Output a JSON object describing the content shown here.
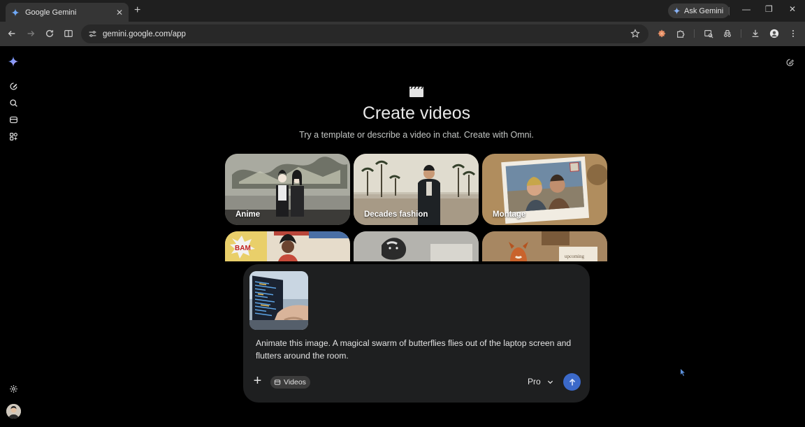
{
  "browser": {
    "tab_title": "Google Gemini",
    "url": "gemini.google.com/app",
    "ask_gemini_label": "Ask Gemini",
    "toolbar_icons": [
      "back-icon",
      "forward-icon",
      "reload-icon",
      "reading-mode-icon",
      "site-settings-icon",
      "bookmark-star-icon",
      "extension-icon",
      "puzzle-icon",
      "screen-capture-icon",
      "incognito-icon",
      "download-icon",
      "profile-icon",
      "menu-icon"
    ]
  },
  "sidebar": {
    "icons": [
      "gemini-logo-icon",
      "new-chat-icon",
      "search-icon",
      "library-icon",
      "gems-icon",
      "settings-icon",
      "avatar"
    ]
  },
  "main": {
    "title": "Create videos",
    "subtitle": "Try a template or describe a video in chat. Create with Omni.",
    "templates": [
      {
        "label": "Anime"
      },
      {
        "label": "Decades fashion"
      },
      {
        "label": "Montage"
      },
      {
        "label": ""
      },
      {
        "label": ""
      },
      {
        "label": ""
      }
    ]
  },
  "composer": {
    "prompt": "Animate this image. A magical swarm of butterflies flies out of the laptop screen and flutters around the room.",
    "tool_chip": "Videos",
    "model": "Pro"
  },
  "colors": {
    "accent_send": "#3b69c9",
    "background": "#000000",
    "composer_bg": "#1e1f20"
  }
}
